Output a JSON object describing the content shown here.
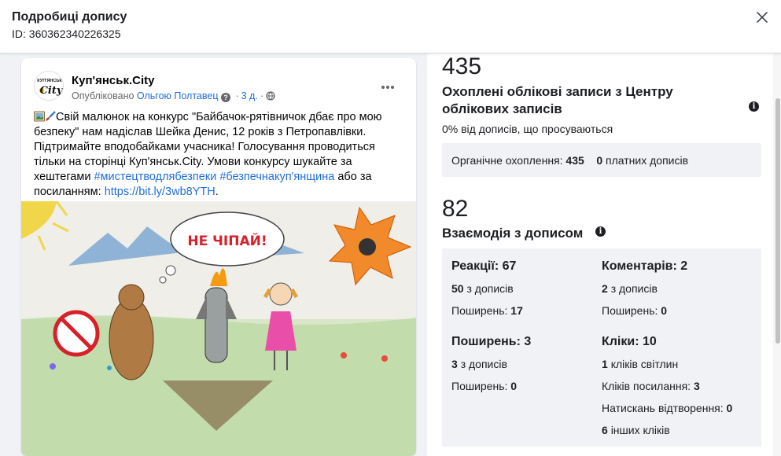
{
  "header": {
    "title": "Подробиці допису",
    "id_text": "ID: 360362340226325"
  },
  "post": {
    "page_name": "Куп'янськ.City",
    "avatar_text_top": "КУП'ЯНСЬК",
    "avatar_text_bottom": "City",
    "published_prefix": "Опубліковано",
    "author": "Ольгою Полтавец",
    "time": "3 д.",
    "text_main": "Свій малюнок на конкурс \"Байбачок-рятівничок дбає про мою безпеку\" нам надіслав Шейка Денис, 12 років з Петропавлівки. Підтримайте вподобайками учасника! Голосування проводиться тільки на сторінці Куп'янськ.City. Умови конкурсу шукайте за хештегами ",
    "hashtag1": "#мистецтводлябезпеки",
    "hashtag2": "#безпечнакуп'янщина",
    "text_mid": " або за посиланням: ",
    "link": "https://bit.ly/3wb8YTH",
    "text_end": ".",
    "drawing_speech": "НЕ ЧІПАЙ!"
  },
  "reach": {
    "number": "435",
    "title": "Охоплені облікові записи з Центру облікових записів",
    "subtitle": "0% від дописів, що просуваються",
    "organic_label": "Органічне охоплення:",
    "organic_value": "435",
    "paid_value": "0",
    "paid_label": "платних дописів"
  },
  "engagement": {
    "number": "82",
    "title": "Взаємодія з дописом",
    "reactions_title": "Реакції: 67",
    "reactions_from_value": "50",
    "reactions_from_label": "з дописів",
    "reactions_shares_label": "Поширень:",
    "reactions_shares_value": "17",
    "comments_title": "Коментарів: 2",
    "comments_from_value": "2",
    "comments_from_label": "з дописів",
    "comments_shares_label": "Поширень:",
    "comments_shares_value": "0",
    "shares_title": "Поширень: 3",
    "shares_from_value": "3",
    "shares_from_label": "з дописів",
    "shares_shares_label": "Поширень:",
    "shares_shares_value": "0",
    "clicks_title": "Кліки: 10",
    "photo_clicks_value": "1",
    "photo_clicks_label": "кліків світлин",
    "link_clicks_label": "Кліків посилання:",
    "link_clicks_value": "3",
    "play_clicks_label": "Натискань відтворення:",
    "play_clicks_value": "0",
    "other_clicks_value": "6",
    "other_clicks_label": "інших кліків"
  }
}
